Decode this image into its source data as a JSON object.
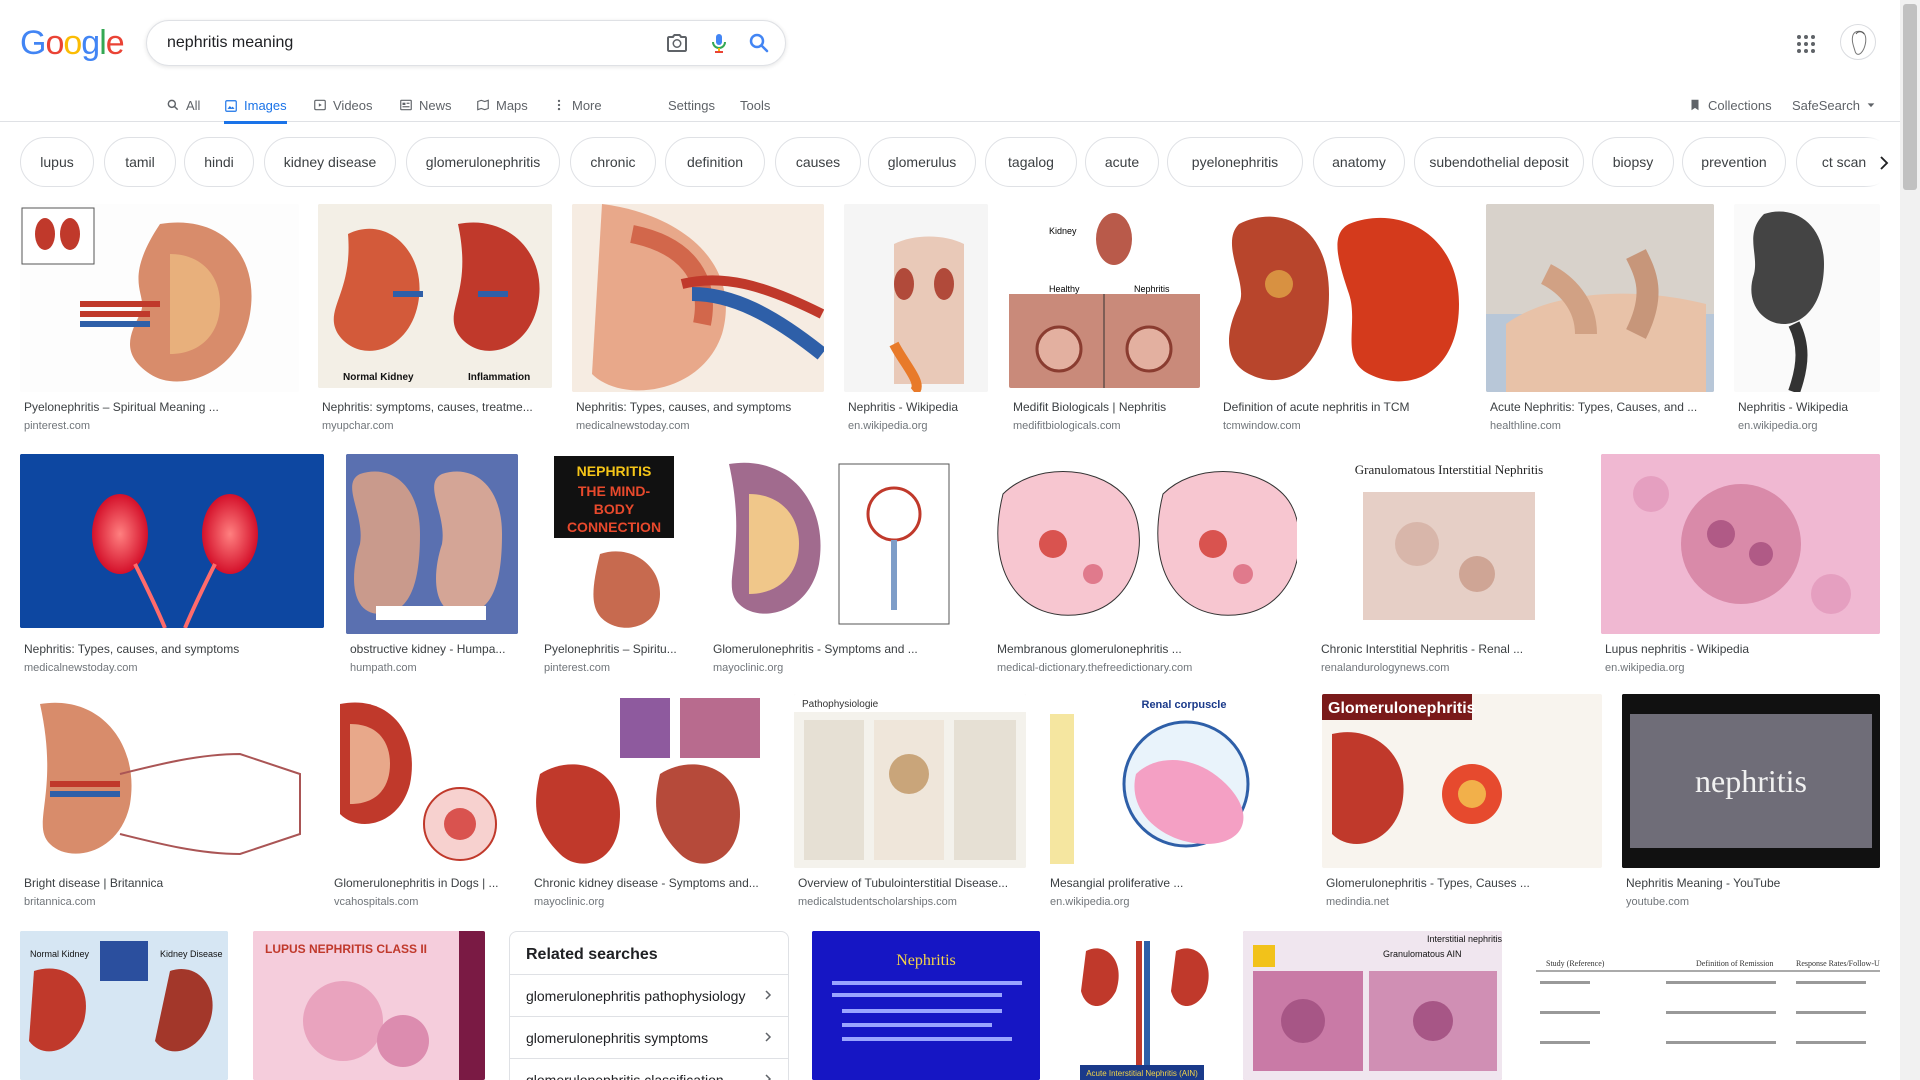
{
  "search": {
    "query": "nephritis meaning"
  },
  "logo": {
    "letters": [
      "G",
      "o",
      "o",
      "g",
      "l",
      "e"
    ],
    "colors": [
      "#4285f4",
      "#ea4335",
      "#fbbc05",
      "#4285f4",
      "#34a853",
      "#ea4335"
    ]
  },
  "nav": {
    "all": "All",
    "images": "Images",
    "videos": "Videos",
    "news": "News",
    "maps": "Maps",
    "more": "More",
    "settings": "Settings",
    "tools": "Tools",
    "collections": "Collections",
    "safesearch": "SafeSearch"
  },
  "chips": [
    "lupus",
    "tamil",
    "hindi",
    "kidney disease",
    "glomerulonephritis",
    "chronic",
    "definition",
    "causes",
    "glomerulus",
    "tagalog",
    "acute",
    "pyelonephritis",
    "anatomy",
    "subendothelial deposit",
    "biopsy",
    "prevention",
    "ct scan"
  ],
  "results": [
    {
      "caption": "Pyelonephritis – Spiritual Meaning ...",
      "source": "pinterest.com"
    },
    {
      "caption": "Nephritis: symptoms, causes, treatme...",
      "source": "myupchar.com"
    },
    {
      "caption": "Nephritis: Types, causes, and symptoms",
      "source": "medicalnewstoday.com"
    },
    {
      "caption": "Nephritis - Wikipedia",
      "source": "en.wikipedia.org"
    },
    {
      "caption": "Medifit Biologicals | Nephritis",
      "source": "medifitbiologicals.com"
    },
    {
      "caption": "Definition of acute nephritis in TCM",
      "source": "tcmwindow.com"
    },
    {
      "caption": "Acute Nephritis: Types, Causes, and ...",
      "source": "healthline.com"
    },
    {
      "caption": "Nephritis - Wikipedia",
      "source": "en.wikipedia.org"
    },
    {
      "caption": "Nephritis: Types, causes, and symptoms",
      "source": "medicalnewstoday.com"
    },
    {
      "caption": "obstructive kidney - Humpa...",
      "source": "humpath.com"
    },
    {
      "caption": "Pyelonephritis – Spiritu...",
      "source": "pinterest.com"
    },
    {
      "caption": "Glomerulonephritis - Symptoms and ...",
      "source": "mayoclinic.org"
    },
    {
      "caption": "Membranous glomerulonephritis ...",
      "source": "medical-dictionary.thefreedictionary.com"
    },
    {
      "caption": "Chronic Interstitial Nephritis - Renal ...",
      "source": "renalandurologynews.com"
    },
    {
      "caption": "Lupus nephritis - Wikipedia",
      "source": "en.wikipedia.org"
    },
    {
      "caption": "Bright disease | Britannica",
      "source": "britannica.com"
    },
    {
      "caption": "Glomerulonephritis in Dogs | ...",
      "source": "vcahospitals.com"
    },
    {
      "caption": "Chronic kidney disease - Symptoms and...",
      "source": "mayoclinic.org"
    },
    {
      "caption": "Overview of Tubulointerstitial Disease...",
      "source": "medicalstudentscholarships.com"
    },
    {
      "caption": "Mesangial proliferative ...",
      "source": "en.wikipedia.org"
    },
    {
      "caption": "Glomerulonephritis - Types, Causes ...",
      "source": "medindia.net"
    },
    {
      "caption": "Nephritis Meaning - YouTube",
      "source": "youtube.com"
    }
  ],
  "thumb_text": {
    "normal_kidney": "Normal Kidney",
    "inflammation": "Inflammation",
    "kidney": "Kidney",
    "healthy": "Healthy",
    "nephritis": "Nephritis",
    "mindbody": [
      "NEPHRITIS",
      "THE MIND-",
      "BODY",
      "CONNECTION"
    ],
    "granulomatous": "Granulomatous Interstitial Nephritis",
    "pathophysiologie": "Pathophysiologie",
    "renal_corpuscle": "Renal corpuscle",
    "glomerulonephritis": "Glomerulonephritis",
    "nephritis_yt": "nephritis",
    "kidney_disease": "Kidney Disease",
    "normal_kidney2": "Normal Kidney",
    "lupus_class": "LUPUS NEPHRITIS CLASS II",
    "nephritis_slide": "Nephritis",
    "acute_ain": "Acute Interstitial Nephritis (AIN)",
    "interstitial_nephritis": "Interstitial nephritis",
    "granulomatous_ain": "Granulomatous AIN",
    "study_reference": "Study (Reference)",
    "definition_remission": "Definition of Remission",
    "response_rates": "Response Rates/Follow-Up"
  },
  "related": {
    "title": "Related searches",
    "items": [
      "glomerulonephritis pathophysiology",
      "glomerulonephritis symptoms",
      "glomerulonephritis classification"
    ]
  },
  "colors": {
    "accent": "#1a73e8",
    "kidney_red": "#c0392b",
    "tissue_pink": "#d98aa9"
  }
}
